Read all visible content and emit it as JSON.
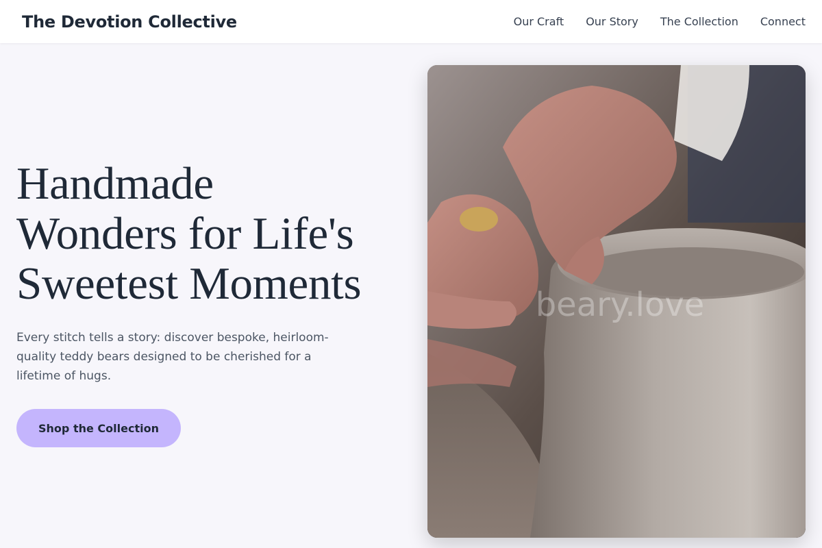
{
  "header": {
    "brand": "The Devotion Collective",
    "nav": [
      "Our Craft",
      "Our Story",
      "The Collection",
      "Connect"
    ]
  },
  "hero": {
    "headline_lines": [
      "Handmade",
      "Wonders for Life's",
      "Sweetest Moments"
    ],
    "subtitle": "Every stitch tells a story: discover bespoke, heirloom-quality teddy bears designed to be cherished for a lifetime of hugs.",
    "cta_label": "Shop the Collection"
  },
  "image": {
    "watermark": "beary.love",
    "subject": "pottery-wheel-hands"
  },
  "colors": {
    "background": "#f7f6fb",
    "header_bg": "#ffffff",
    "text": "#1f2937",
    "subtext": "#4b5563",
    "accent": "#c4b5fd"
  }
}
